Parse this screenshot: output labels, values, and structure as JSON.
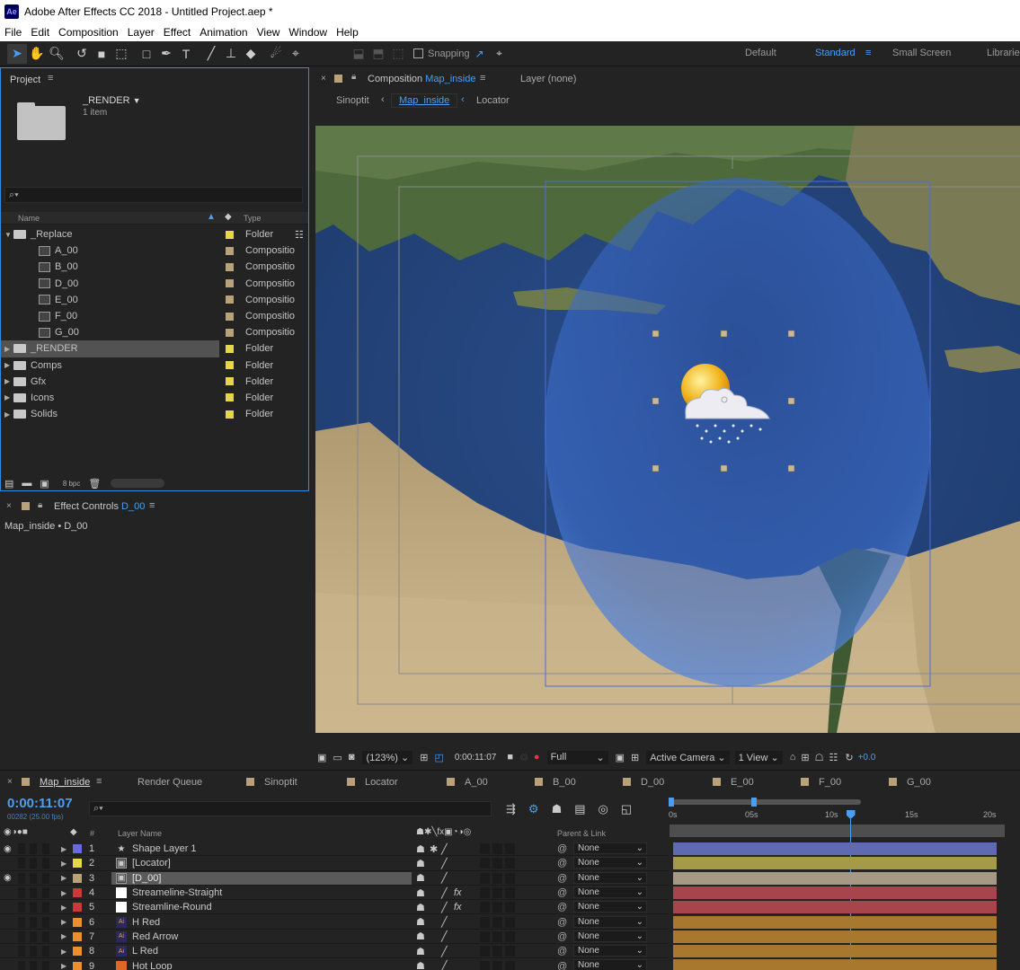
{
  "app": {
    "title": "Adobe After Effects CC 2018 - Untitled Project.aep *",
    "logo": "Ae"
  },
  "menu": [
    "File",
    "Edit",
    "Composition",
    "Layer",
    "Effect",
    "Animation",
    "View",
    "Window",
    "Help"
  ],
  "toolbar": {
    "snapping_label": "Snapping",
    "workspaces": [
      "Default",
      "Standard",
      "Small Screen",
      "Librarie"
    ]
  },
  "project": {
    "title": "Project",
    "selected_name": "_RENDER",
    "selected_count": "1 item",
    "search_placeholder": "",
    "col_name": "Name",
    "col_type": "Type",
    "items": [
      {
        "name": "_Replace",
        "type": "Folder",
        "kind": "folder",
        "indent": 0,
        "open": true,
        "label_color": "#e6d64a"
      },
      {
        "name": "A_00",
        "type": "Compositio",
        "kind": "comp",
        "indent": 1,
        "label_color": "#b9a27a"
      },
      {
        "name": "B_00",
        "type": "Compositio",
        "kind": "comp",
        "indent": 1,
        "label_color": "#b9a27a"
      },
      {
        "name": "D_00",
        "type": "Compositio",
        "kind": "comp",
        "indent": 1,
        "label_color": "#b9a27a"
      },
      {
        "name": "E_00",
        "type": "Compositio",
        "kind": "comp",
        "indent": 1,
        "label_color": "#b9a27a"
      },
      {
        "name": "F_00",
        "type": "Compositio",
        "kind": "comp",
        "indent": 1,
        "label_color": "#b9a27a"
      },
      {
        "name": "G_00",
        "type": "Compositio",
        "kind": "comp",
        "indent": 1,
        "label_color": "#b9a27a"
      },
      {
        "name": "_RENDER",
        "type": "Folder",
        "kind": "folder",
        "indent": 0,
        "selected": true,
        "label_color": "#e6d64a"
      },
      {
        "name": "Comps",
        "type": "Folder",
        "kind": "folder",
        "indent": 0,
        "label_color": "#e6d64a"
      },
      {
        "name": "Gfx",
        "type": "Folder",
        "kind": "folder",
        "indent": 0,
        "label_color": "#e6d64a"
      },
      {
        "name": "Icons",
        "type": "Folder",
        "kind": "folder",
        "indent": 0,
        "label_color": "#e6d64a"
      },
      {
        "name": "Solids",
        "type": "Folder",
        "kind": "folder",
        "indent": 0,
        "label_color": "#e6d64a"
      }
    ],
    "bpc": "8 bpc"
  },
  "effect_controls": {
    "title": "Effect Controls",
    "layer": "D_00",
    "subtitle": "Map_inside • D_00"
  },
  "composition": {
    "tab_label": "Composition",
    "comp_name": "Map_inside",
    "layer_tab": "Layer (none)",
    "breadcrumbs": [
      "Sinoptit",
      "Map_inside",
      "Locator"
    ],
    "zoom": "(123%)",
    "timecode": "0:00:11:07",
    "resolution": "Full",
    "camera": "Active Camera",
    "views": "1 View",
    "exposure": "+0.0"
  },
  "timeline": {
    "tabs": [
      {
        "label": "Map_inside",
        "color": "#b9a27a",
        "active": true
      },
      {
        "label": "Render Queue",
        "color": null
      },
      {
        "label": "Sinoptit",
        "color": "#b9a27a"
      },
      {
        "label": "Locator",
        "color": "#b9a27a"
      },
      {
        "label": "A_00",
        "color": "#b9a27a"
      },
      {
        "label": "B_00",
        "color": "#b9a27a"
      },
      {
        "label": "D_00",
        "color": "#b9a27a"
      },
      {
        "label": "E_00",
        "color": "#b9a27a"
      },
      {
        "label": "F_00",
        "color": "#b9a27a"
      },
      {
        "label": "G_00",
        "color": "#b9a27a"
      }
    ],
    "current_time": "0:00:11:07",
    "fps_line": "00282 (25.00 fps)",
    "col_hash": "#",
    "col_layer": "Layer Name",
    "col_parent": "Parent & Link",
    "ruler": [
      "0s",
      "05s",
      "10s",
      "15s",
      "20s"
    ],
    "playhead_seconds": 11.28,
    "ruler_max_seconds": 20,
    "layers": [
      {
        "num": "1",
        "name": "Shape Layer 1",
        "color": "#6a6adc",
        "icon": "star",
        "fx": false,
        "parent": "None",
        "bar": "#5f6ab0",
        "eye": true
      },
      {
        "num": "2",
        "name": "[Locator]",
        "color": "#e6d64a",
        "icon": "comp",
        "fx": false,
        "parent": "None",
        "bar": "#a59a48",
        "eye": false
      },
      {
        "num": "3",
        "name": "[D_00]",
        "color": "#b9a27a",
        "icon": "comp",
        "fx": false,
        "parent": "None",
        "bar": "#a69a84",
        "eye": true,
        "selected": true
      },
      {
        "num": "4",
        "name": "Streameline-Straight",
        "color": "#c93a3a",
        "icon": "white",
        "fx": true,
        "parent": "None",
        "bar": "#a8444c",
        "eye": false
      },
      {
        "num": "5",
        "name": "Streamline-Round",
        "color": "#c93a3a",
        "icon": "white",
        "fx": true,
        "parent": "None",
        "bar": "#a8444c",
        "eye": false
      },
      {
        "num": "6",
        "name": "H Red",
        "color": "#e89228",
        "icon": "ai",
        "fx": false,
        "parent": "None",
        "bar": "#a8782e",
        "eye": false
      },
      {
        "num": "7",
        "name": "Red Arrow",
        "color": "#e89228",
        "icon": "ai",
        "fx": false,
        "parent": "None",
        "bar": "#a8782e",
        "eye": false
      },
      {
        "num": "8",
        "name": "L Red",
        "color": "#e89228",
        "icon": "ai",
        "fx": false,
        "parent": "None",
        "bar": "#a8782e",
        "eye": false
      },
      {
        "num": "9",
        "name": "Hot Loop",
        "color": "#e89228",
        "icon": "orange",
        "fx": false,
        "parent": "None",
        "bar": "#a8782e",
        "eye": false
      }
    ]
  }
}
